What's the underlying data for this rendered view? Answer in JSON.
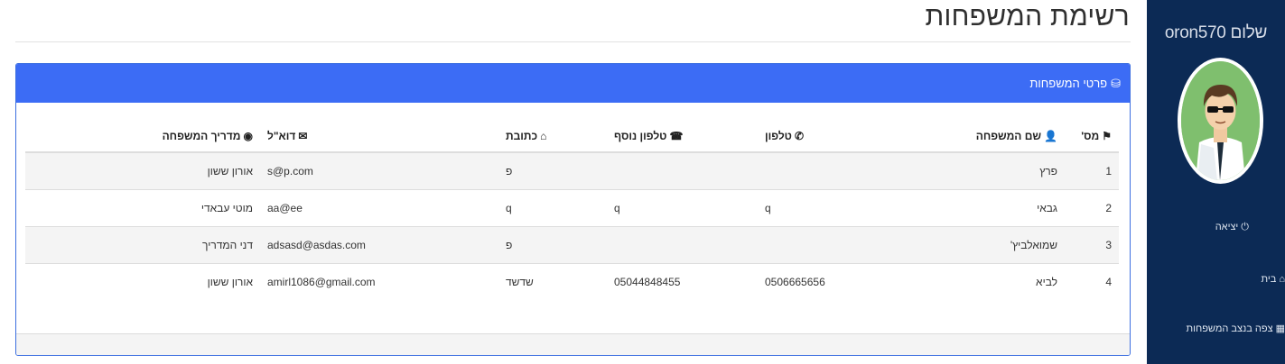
{
  "sidebar": {
    "greeting": "שלום oron570",
    "logout": "יציאה",
    "home": "בית",
    "view_families": "צפה בנצב המשפחות"
  },
  "page": {
    "title": "רשימת המשפחות"
  },
  "panel": {
    "heading": "פרטי המשפחות"
  },
  "table": {
    "headers": {
      "num": "מס'",
      "family_name": "שם המשפחה",
      "phone": "טלפון",
      "extra_phone": "טלפון נוסף",
      "address": "כתובת",
      "email": "דוא\"ל",
      "guide": "מדריך המשפחה"
    },
    "rows": [
      {
        "num": "1",
        "family_name": "פרץ",
        "phone": "",
        "extra_phone": "",
        "address": "פ",
        "email": "s@p.com",
        "guide": "אורון ששון"
      },
      {
        "num": "2",
        "family_name": "גבאי",
        "phone": "q",
        "extra_phone": "q",
        "address": "q",
        "email": "aa@ee",
        "guide": "מוטי עבאדי"
      },
      {
        "num": "3",
        "family_name": "שמואלביץ'",
        "phone": "",
        "extra_phone": "",
        "address": "פ",
        "email": "adsasd@asdas.com",
        "guide": "דני המדריך"
      },
      {
        "num": "4",
        "family_name": "לביא",
        "phone": "0506665656",
        "extra_phone": "05044848455",
        "address": "שדשד",
        "email": "amirl1086@gmail.com",
        "guide": "אורון ששון"
      }
    ]
  },
  "icons": {
    "flag": "flag-icon",
    "user": "user-icon",
    "phone": "phone-icon",
    "phone_alt": "phone-alt-icon",
    "home": "home-icon",
    "envelope": "envelope-icon",
    "eye": "eye-icon",
    "database": "database-icon",
    "power": "power-icon"
  },
  "colors": {
    "sidebar": "#0c2a55",
    "panel_heading": "#3c6cf5",
    "avatar_bg": "#7fbf6e"
  }
}
